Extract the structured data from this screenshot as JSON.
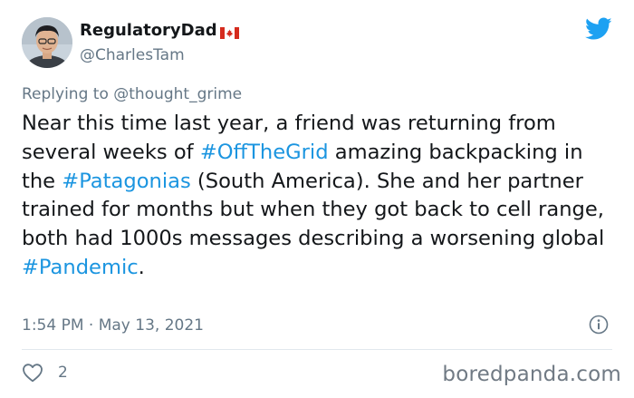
{
  "tweet": {
    "display_name": "RegulatoryDad",
    "handle": "@CharlesTam",
    "reply_prefix": "Replying to ",
    "reply_to": "@thought_grime",
    "text_segments": [
      {
        "text": "Near this time last year, a friend was returning from several weeks of ",
        "type": "text"
      },
      {
        "text": "#OffTheGrid",
        "type": "hashtag"
      },
      {
        "text": " amazing backpacking in the ",
        "type": "text"
      },
      {
        "text": "#Patagonias",
        "type": "hashtag"
      },
      {
        "text": " (South America). She and her partner trained for months but when they got back to cell range, both had 1000s messages describing a worsening global ",
        "type": "text"
      },
      {
        "text": "#Pandemic",
        "type": "hashtag"
      },
      {
        "text": ".",
        "type": "text"
      }
    ],
    "timestamp": "1:54 PM · May 13, 2021",
    "like_count": "2"
  },
  "icons": {
    "flag": "canada-flag-icon",
    "bird": "twitter-bird-icon",
    "info": "info-icon",
    "heart": "heart-icon"
  },
  "colors": {
    "link": "#1b95e0",
    "twitter_blue": "#1da1f2",
    "secondary_text": "#657786"
  },
  "watermark": "boredpanda.com"
}
